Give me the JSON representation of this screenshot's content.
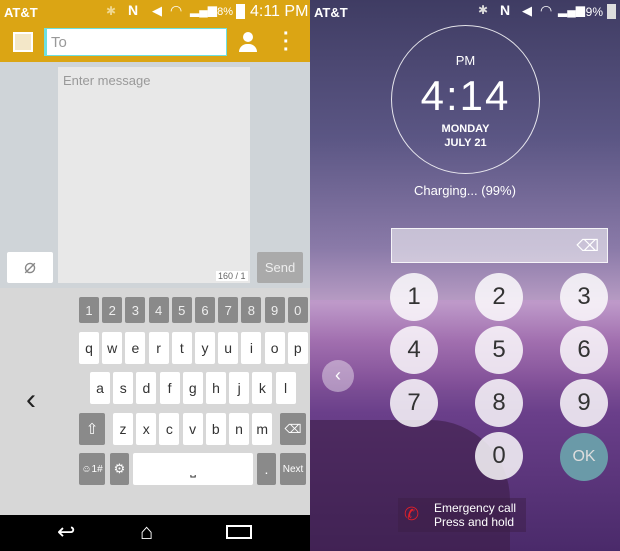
{
  "left": {
    "status": {
      "carrier": "AT&T",
      "battery": "98%",
      "time": "4:11 PM"
    },
    "header": {
      "to_placeholder": "To"
    },
    "compose": {
      "placeholder": "Enter message",
      "counter": "160 / 1",
      "send_label": "Send"
    },
    "keyboard": {
      "numbers": [
        "1",
        "2",
        "3",
        "4",
        "5",
        "6",
        "7",
        "8",
        "9",
        "0"
      ],
      "row1": [
        "q",
        "w",
        "e",
        "r",
        "t",
        "y",
        "u",
        "i",
        "o",
        "p"
      ],
      "row2": [
        "a",
        "s",
        "d",
        "f",
        "g",
        "h",
        "j",
        "k",
        "l"
      ],
      "row3": [
        "z",
        "x",
        "c",
        "v",
        "b",
        "n",
        "m"
      ],
      "symbols_label": "☺1#",
      "period": ".",
      "next_label": "Next"
    },
    "colors": {
      "accent": "#dba514"
    }
  },
  "right": {
    "status": {
      "carrier": "AT&T",
      "battery": "99%"
    },
    "clock": {
      "ampm": "PM",
      "time": "4:14",
      "day": "MONDAY",
      "date": "JULY 21"
    },
    "charging": "Charging... (99%)",
    "keypad": [
      "1",
      "2",
      "3",
      "4",
      "5",
      "6",
      "7",
      "8",
      "9",
      "0"
    ],
    "ok_label": "OK",
    "emergency": {
      "line1": "Emergency call",
      "line2": "Press and hold"
    },
    "colors": {
      "ok": "#6a9aa8",
      "phone": "#e0202a"
    }
  }
}
